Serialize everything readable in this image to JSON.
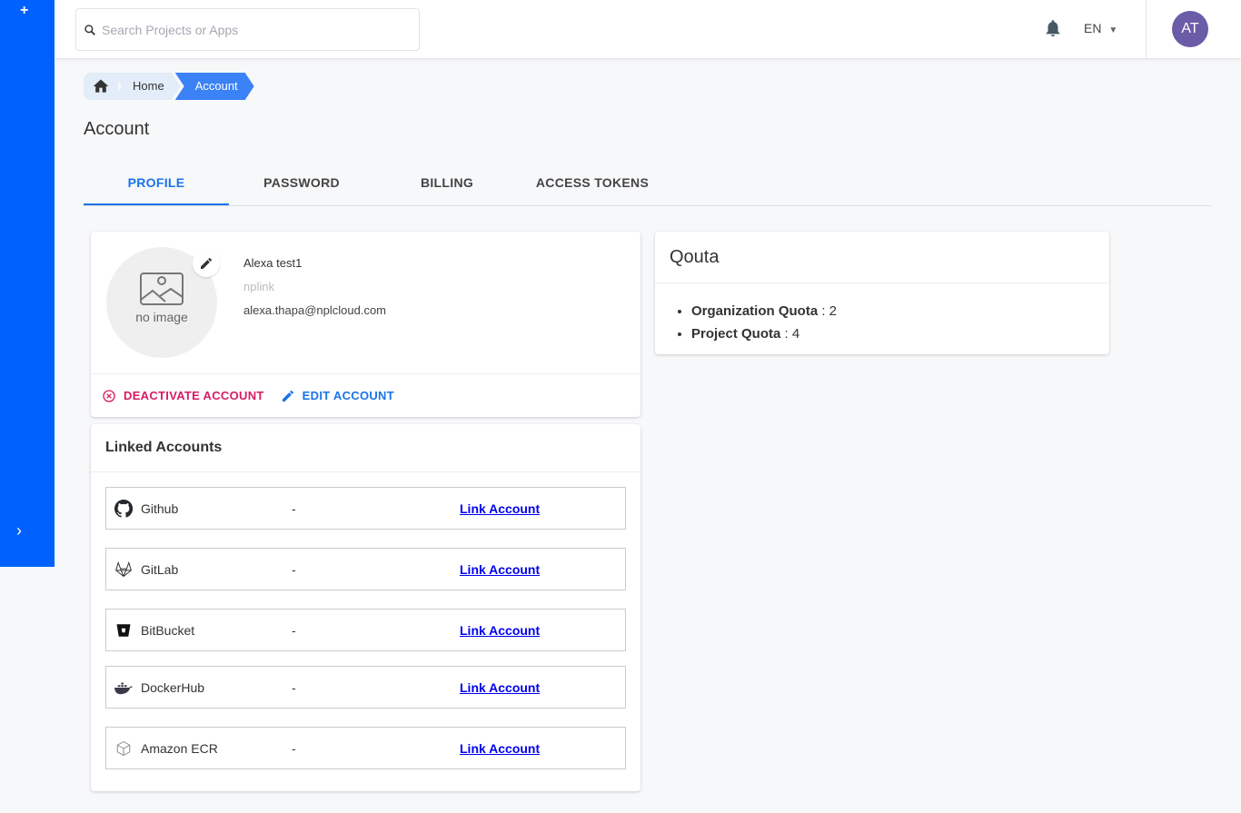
{
  "sidebar": {
    "add_icon": "plus",
    "expand_icon": "chevron-right"
  },
  "topbar": {
    "search_placeholder": "Search Projects or Apps",
    "language": "EN",
    "avatar_initials": "AT"
  },
  "breadcrumb": [
    "Home",
    "Account"
  ],
  "page_title": "Account",
  "tabs": [
    "PROFILE",
    "PASSWORD",
    "BILLING",
    "ACCESS TOKENS"
  ],
  "active_tab": "PROFILE",
  "profile": {
    "no_image": "no image",
    "name": "Alexa test1",
    "org": "nplink",
    "email": "alexa.thapa@nplcloud.com",
    "deactivate": "DEACTIVATE ACCOUNT",
    "edit": "EDIT ACCOUNT"
  },
  "linked": {
    "title": "Linked Accounts",
    "rows": [
      {
        "name": "Github",
        "value": "-",
        "action": "Link Account",
        "icon": "github"
      },
      {
        "name": "GitLab",
        "value": "-",
        "action": "Link Account",
        "icon": "gitlab"
      },
      {
        "name": "BitBucket",
        "value": "-",
        "action": "Link Account",
        "icon": "bitbucket"
      },
      {
        "name": "DockerHub",
        "value": "-",
        "action": "Link Account",
        "icon": "docker"
      },
      {
        "name": "Amazon ECR",
        "value": "-",
        "action": "Link Account",
        "icon": "aws-ecr"
      }
    ]
  },
  "quota": {
    "title": "Qouta",
    "items": [
      {
        "label": "Organization Quota",
        "value": " : 2"
      },
      {
        "label": "Project Quota",
        "value": " : 4"
      }
    ]
  },
  "colors": {
    "primary": "#0061ff",
    "danger": "#d81b60",
    "link": "#1a73e8"
  }
}
